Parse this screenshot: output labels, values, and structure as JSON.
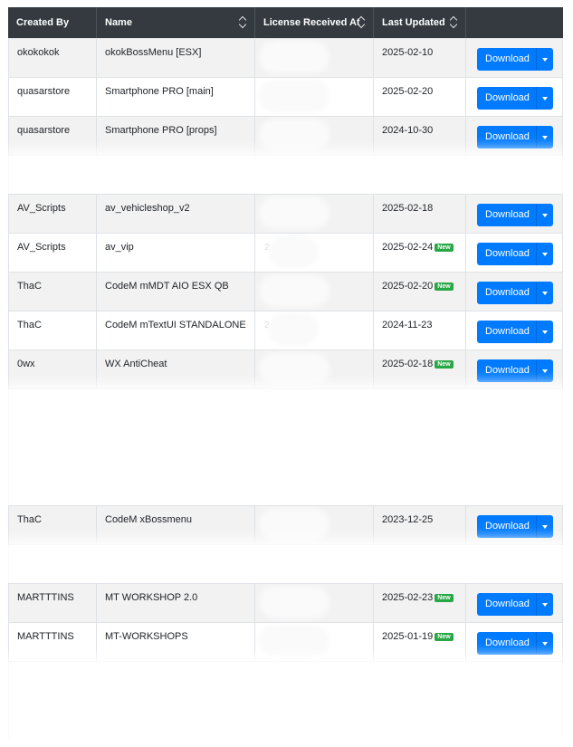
{
  "headers": {
    "created_by": "Created By",
    "name": "Name",
    "license_received_at": "License Received At",
    "last_updated": "Last Updated"
  },
  "rows": [
    {
      "created_by": "okokokok",
      "name": "okokBossMenu [ESX]",
      "license_received_at": "",
      "last_updated": "2025-02-10",
      "is_new": false,
      "action": "Download"
    },
    {
      "created_by": "quasarstore",
      "name": "Smartphone PRO [main]",
      "license_received_at": "",
      "last_updated": "2025-02-20",
      "is_new": false,
      "action": "Download"
    },
    {
      "created_by": "quasarstore",
      "name": "Smartphone PRO [props]",
      "license_received_at": "",
      "last_updated": "2024-10-30",
      "is_new": false,
      "action": "Download"
    },
    {
      "created_by": "AV_Scripts",
      "name": "av_vehicleshop_v2",
      "license_received_at": "",
      "last_updated": "2025-02-18",
      "is_new": false,
      "action": "Download"
    },
    {
      "created_by": "AV_Scripts",
      "name": "av_vip",
      "license_received_at": "2",
      "last_updated": "2025-02-24",
      "is_new": true,
      "action": "Download"
    },
    {
      "created_by": "ThaC",
      "name": "CodeM mMDT AIO ESX QB",
      "license_received_at": "",
      "last_updated": "2025-02-20",
      "is_new": true,
      "action": "Download"
    },
    {
      "created_by": "ThaC",
      "name": "CodeM mTextUI STANDALONE",
      "license_received_at": "2",
      "last_updated": "2024-11-23",
      "is_new": false,
      "action": "Download"
    },
    {
      "created_by": "0wx",
      "name": "WX AntiCheat",
      "license_received_at": "",
      "last_updated": "2025-02-18",
      "is_new": true,
      "action": "Download"
    },
    {
      "created_by": "ThaC",
      "name": "CodeM xBossmenu",
      "license_received_at": "",
      "last_updated": "2023-12-25",
      "is_new": false,
      "action": "Download"
    },
    {
      "created_by": "MARTTTINS",
      "name": "MT WORKSHOP 2.0",
      "license_received_at": "",
      "last_updated": "2025-02-23",
      "is_new": true,
      "action": "Download"
    },
    {
      "created_by": "MARTTTINS",
      "name": "MT-WORKSHOPS",
      "license_received_at": "",
      "last_updated": "2025-01-19",
      "is_new": true,
      "action": "Download"
    }
  ],
  "new_badge": "New",
  "colors": {
    "header_bg": "#343a40",
    "button_bg": "#007bff",
    "badge_bg": "#28a745"
  }
}
